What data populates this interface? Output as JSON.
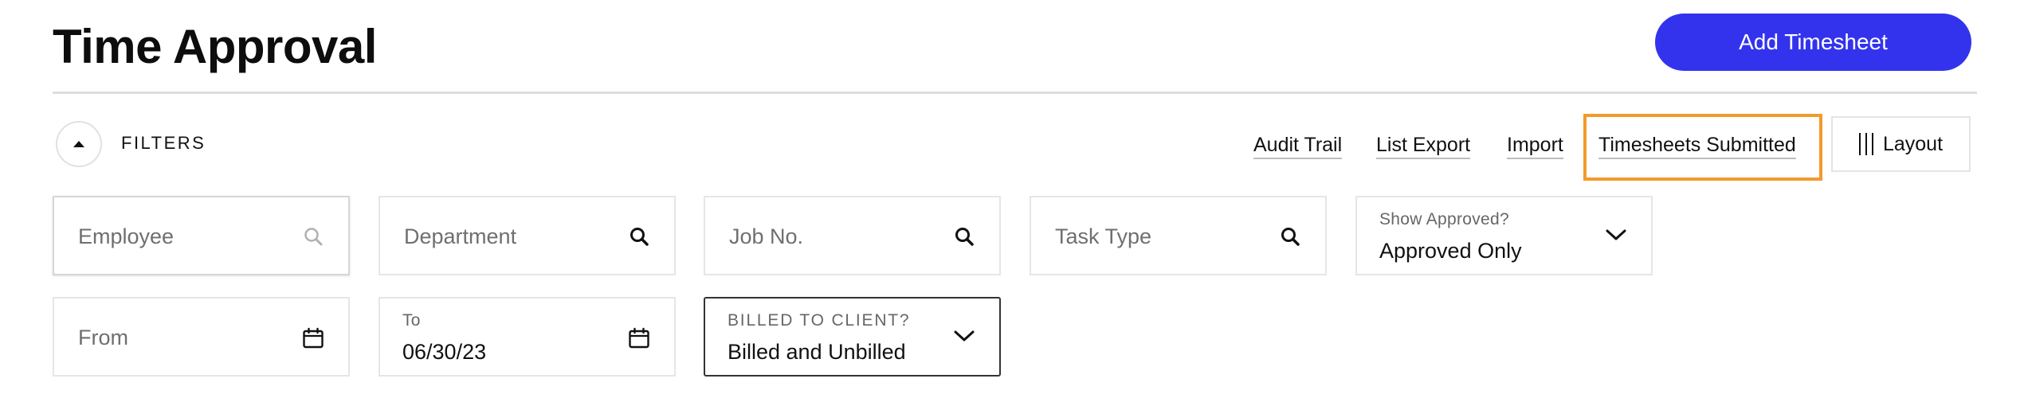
{
  "header": {
    "title": "Time Approval",
    "add_button_label": "Add Timesheet"
  },
  "filters": {
    "label": "FILTERS",
    "actions": {
      "audit_trail": "Audit Trail",
      "list_export": "List Export",
      "import": "Import",
      "timesheets_submitted": "Timesheets Submitted",
      "layout": "Layout"
    },
    "fields": {
      "employee": {
        "placeholder": "Employee",
        "icon": "search-icon"
      },
      "department": {
        "placeholder": "Department",
        "icon": "search-icon"
      },
      "job_no": {
        "placeholder": "Job No.",
        "icon": "search-icon"
      },
      "task_type": {
        "placeholder": "Task Type",
        "icon": "search-icon"
      },
      "show_approved": {
        "label": "Show Approved?",
        "value": "Approved Only",
        "icon": "chevron-down-icon"
      },
      "from": {
        "placeholder": "From",
        "icon": "calendar-icon"
      },
      "to": {
        "label": "To",
        "value": "06/30/23",
        "icon": "calendar-icon"
      },
      "billed_to_client": {
        "label": "BILLED TO CLIENT?",
        "value": "Billed and Unbilled",
        "icon": "chevron-down-icon"
      }
    }
  },
  "colors": {
    "primary": "#3333ee",
    "highlight": "#f39a2b"
  }
}
